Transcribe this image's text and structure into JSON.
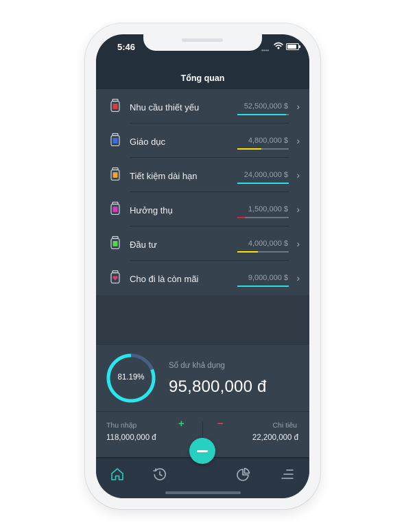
{
  "status": {
    "time": "5:46",
    "signal": "••••"
  },
  "header": {
    "title": "Tổng quan"
  },
  "jars": [
    {
      "name": "Nhu cầu thiết yếu",
      "amount": "52,500,000 $",
      "progress": 0.95,
      "color": "#29e0e0",
      "jar_color": "#e23a3a"
    },
    {
      "name": "Giáo dục",
      "amount": "4,800,000 $",
      "progress": 0.47,
      "color": "#ffe000",
      "jar_color": "#3b6fe0"
    },
    {
      "name": "Tiết kiệm dài hạn",
      "amount": "24,000,000 $",
      "progress": 1.0,
      "color": "#29e0e0",
      "jar_color": "#f2a33a"
    },
    {
      "name": "Hưởng thụ",
      "amount": "1,500,000 $",
      "progress": 0.15,
      "color": "#e0202e",
      "jar_color": "#d63ac0"
    },
    {
      "name": "Đầu tư",
      "amount": "4,000,000 $",
      "progress": 0.4,
      "color": "#ffe000",
      "jar_color": "#56d24a"
    },
    {
      "name": "Cho đi là còn mãi",
      "amount": "9,000,000 $",
      "progress": 1.0,
      "color": "#29e0e0",
      "jar_color": "#e23a6a"
    }
  ],
  "summary": {
    "percent_label": "81.19%",
    "percent": 0.8119,
    "available_label": "Số dư khả dụng",
    "available_value": "95,800,000 đ"
  },
  "flows": {
    "income_label": "Thu nhập",
    "income_value": "118,000,000 đ",
    "plus": "+",
    "minus": "−",
    "expense_label": "Chi tiêu",
    "expense_value": "22,200,000 đ"
  },
  "tabs": [
    {
      "id": "home",
      "icon": "home-icon",
      "active": true
    },
    {
      "id": "history",
      "icon": "history-icon",
      "active": false
    },
    {
      "id": "report",
      "icon": "pie-chart-icon",
      "active": false
    },
    {
      "id": "menu",
      "icon": "menu-icon",
      "active": false
    }
  ],
  "colors": {
    "accent": "#25d0c0",
    "income": "#2bd07a",
    "expense": "#e83b4a"
  }
}
